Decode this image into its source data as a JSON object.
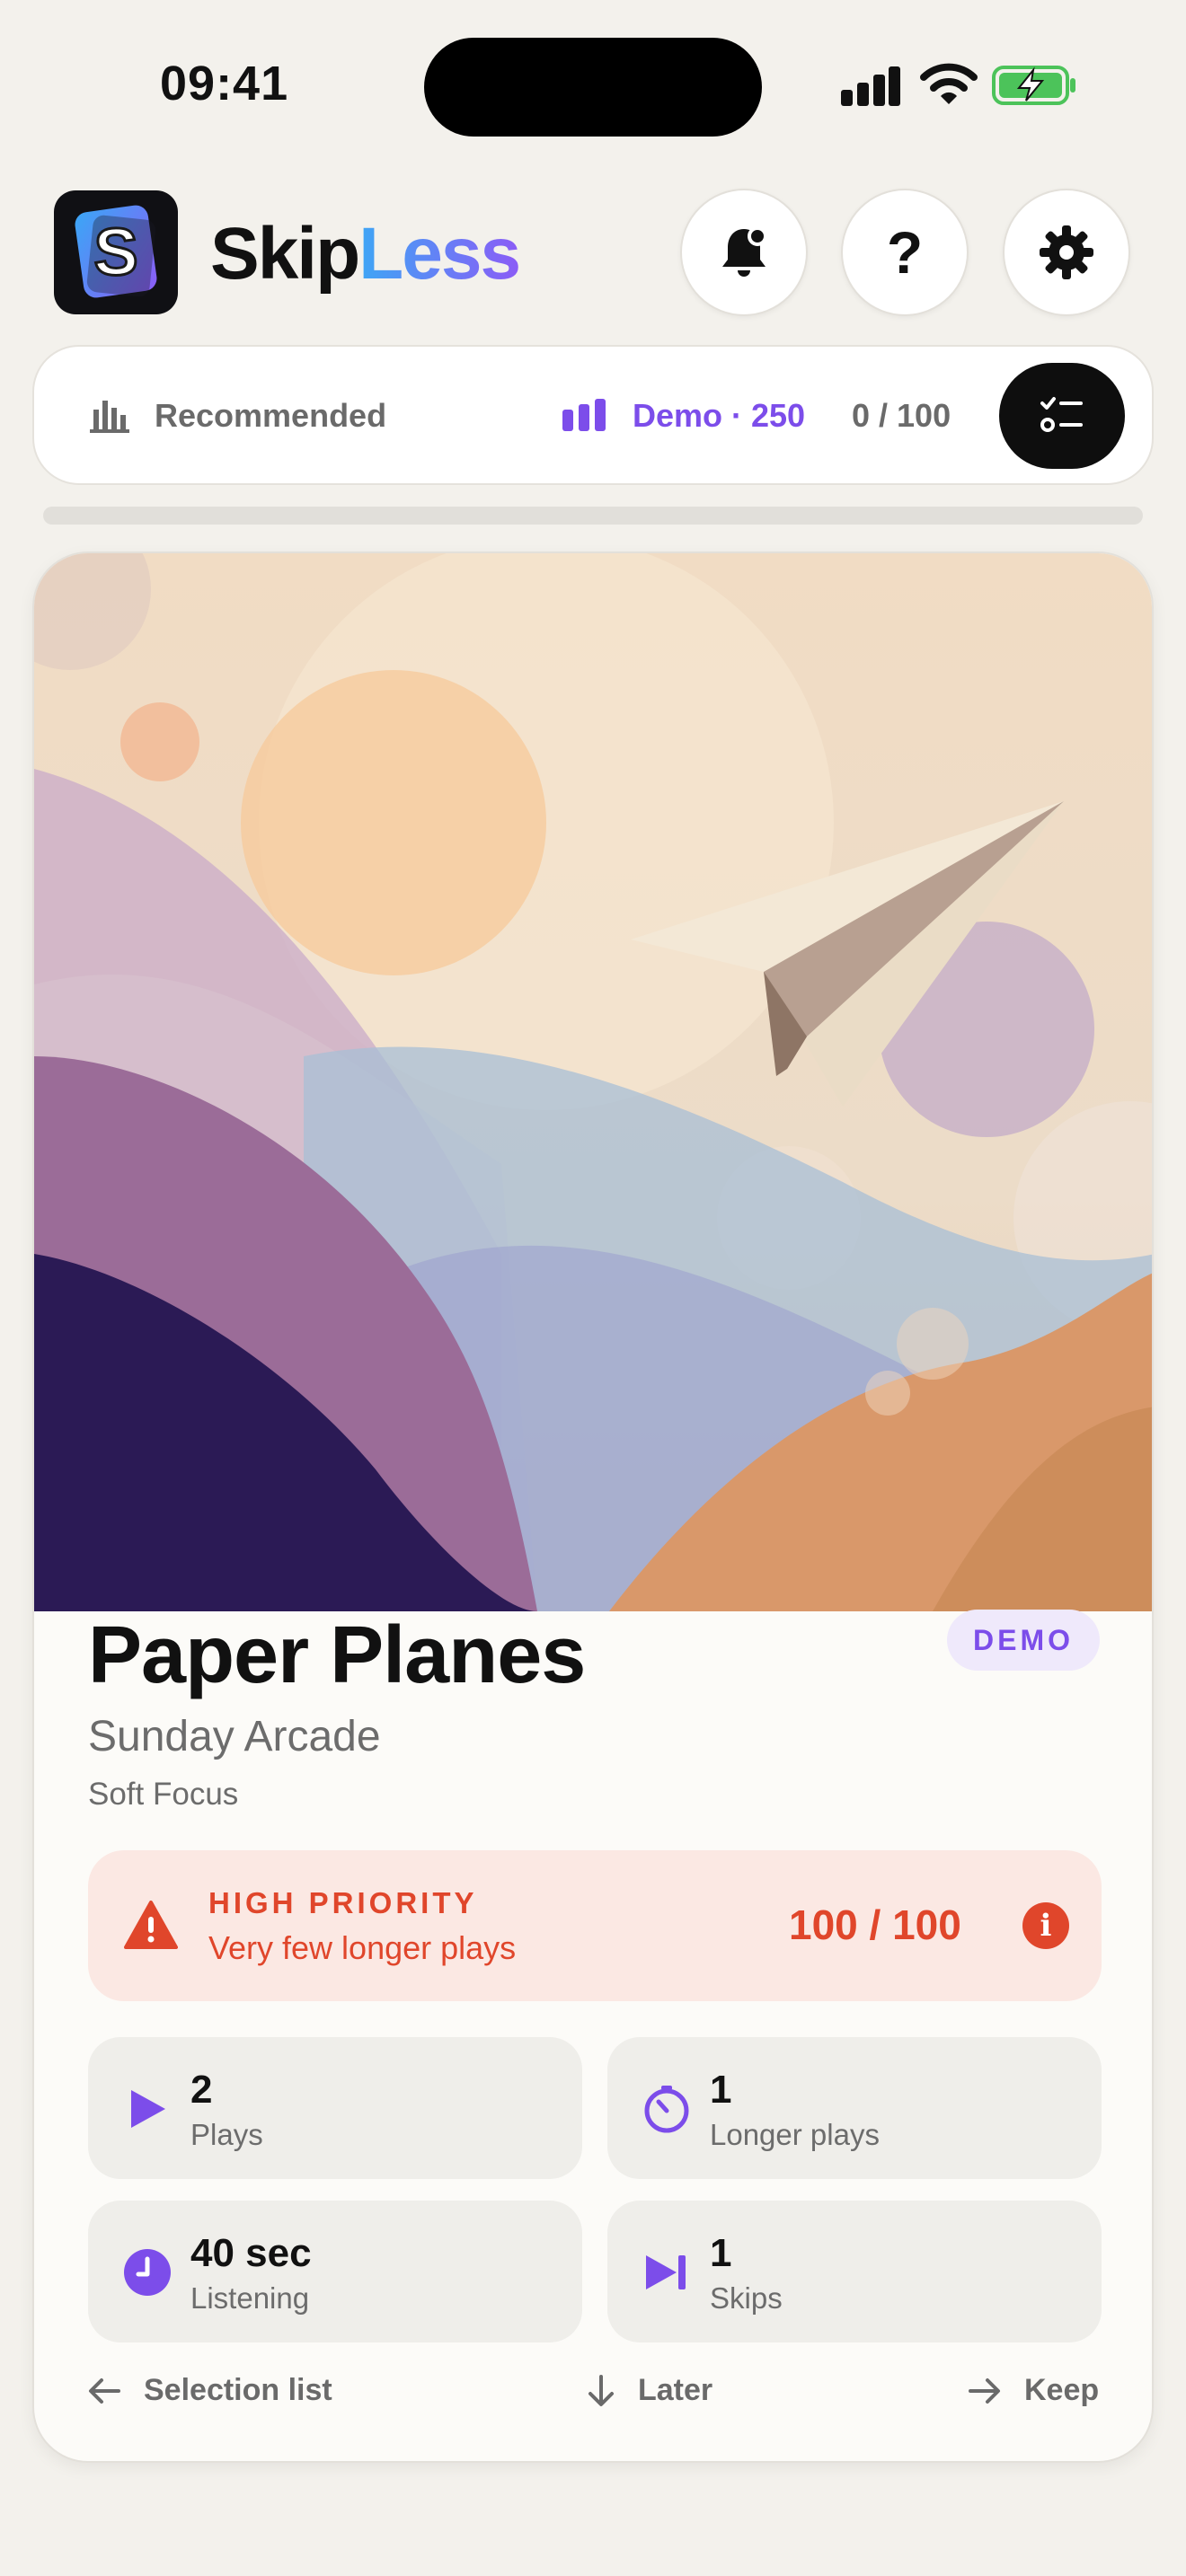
{
  "status_bar": {
    "time": "09:41"
  },
  "header": {
    "app_name_part1": "Skip",
    "app_name_part2": "Less",
    "logo_letter": "S",
    "help_label": "?"
  },
  "filter_bar": {
    "sort_label": "Recommended",
    "demo_label": "Demo · 250",
    "count_label": "0 / 100"
  },
  "progress": {
    "value": 0
  },
  "track": {
    "title": "Paper Planes",
    "badge": "DEMO",
    "artist": "Sunday Arcade",
    "album": "Soft Focus"
  },
  "priority": {
    "title": "HIGH PRIORITY",
    "subtitle": "Very few longer plays",
    "score": "100 / 100",
    "info_icon": "i"
  },
  "stats": {
    "plays": {
      "value": "2",
      "label": "Plays"
    },
    "longer": {
      "value": "1",
      "label": "Longer plays"
    },
    "listening": {
      "value": "40 sec",
      "label": "Listening"
    },
    "skips": {
      "value": "1",
      "label": "Skips"
    }
  },
  "actions": {
    "selection": "Selection list",
    "later": "Later",
    "keep": "Keep"
  },
  "colors": {
    "accent_purple": "#7c4dea",
    "priority_red": "#e0462b",
    "background": "#f3f1ec"
  }
}
